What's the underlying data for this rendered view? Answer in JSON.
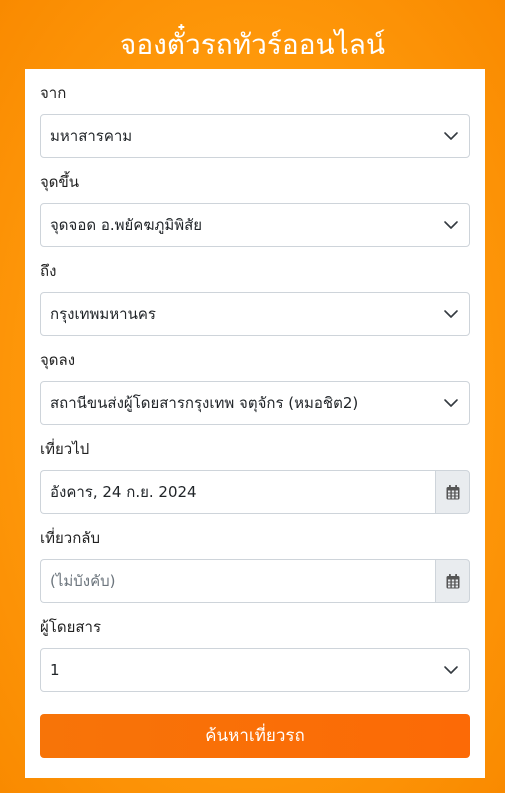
{
  "header": {
    "title": "จองตั๋วรถทัวร์ออนไลน์"
  },
  "form": {
    "origin": {
      "label": "จาก",
      "value": "มหาสารคาม"
    },
    "pickup": {
      "label": "จุดขึ้น",
      "value": "จุดจอด อ.พยัคฆภูมิพิสัย"
    },
    "destination": {
      "label": "ถึง",
      "value": "กรุงเทพมหานคร"
    },
    "dropoff": {
      "label": "จุดลง",
      "value": "สถานีขนส่งผู้โดยสารกรุงเทพ จตุจักร (หมอชิต2)"
    },
    "depart_date": {
      "label": "เที่ยวไป",
      "value": "อังคาร, 24 ก.ย. 2024"
    },
    "return_date": {
      "label": "เที่ยวกลับ",
      "value": "",
      "placeholder": "(ไม่บังคับ)"
    },
    "passengers": {
      "label": "ผู้โดยสาร",
      "value": "1"
    },
    "submit_label": "ค้นหาเที่ยวรถ"
  },
  "icons": {
    "select_arrow": "chevron-down-icon",
    "date_picker": "calendar-icon"
  },
  "colors": {
    "background": "#ff9a0c",
    "button": "#f77408",
    "addon": "#e9ecef",
    "border": "#ced4da"
  }
}
